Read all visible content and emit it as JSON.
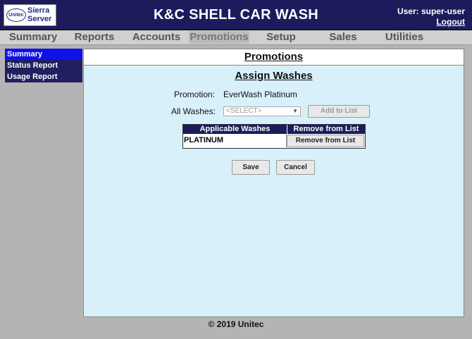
{
  "logo": {
    "oval": "Unitec",
    "line1": "Sierra",
    "line2": "Server"
  },
  "app_title": "K&C SHELL CAR WASH",
  "user": {
    "label": "User: super-user",
    "logout": "Logout"
  },
  "tabs": [
    {
      "label": "Summary"
    },
    {
      "label": "Reports"
    },
    {
      "label": "Accounts"
    },
    {
      "label": "Promotions"
    },
    {
      "label": "Setup"
    },
    {
      "label": "Sales"
    },
    {
      "label": "Utilities"
    }
  ],
  "active_tab": "Promotions",
  "sidebar": {
    "items": [
      {
        "label": "Summary"
      },
      {
        "label": "Status Report"
      },
      {
        "label": "Usage Report"
      }
    ]
  },
  "page": {
    "header": "Promotions",
    "subtitle": "Assign Washes",
    "promotion_label": "Promotion:",
    "promotion_value": "EverWash Platinum",
    "all_washes_label": "All Washes:",
    "select_value": "<SELECT>",
    "add_button": "Add to List",
    "table": {
      "headers": [
        "Applicable Washes",
        "Remove from List"
      ],
      "rows": [
        {
          "wash": "PLATINUM",
          "action": "Remove from List"
        }
      ]
    },
    "save_button": "Save",
    "cancel_button": "Cancel"
  },
  "footer": "© 2019 Unitec",
  "colors": {
    "header_bg": "#1c1c5c",
    "content_bg": "#d8f0fa",
    "active_side": "#1010e8"
  }
}
